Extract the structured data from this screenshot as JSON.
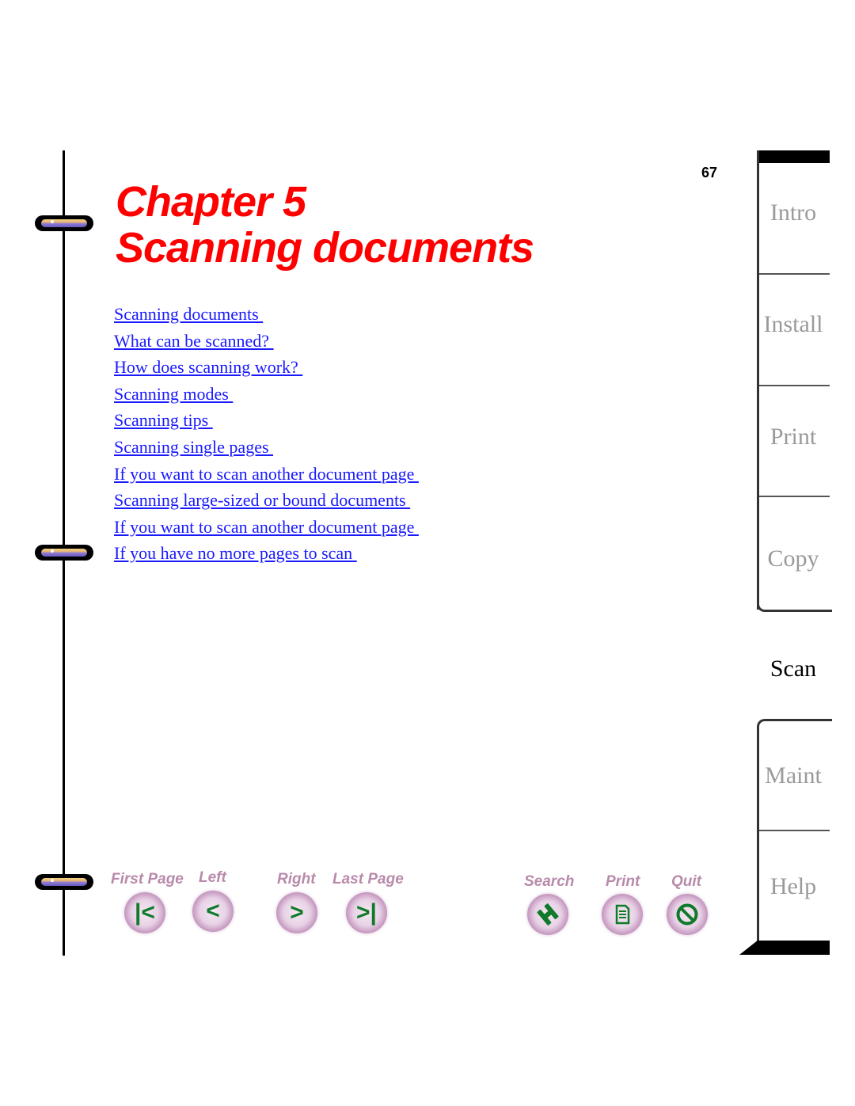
{
  "page": {
    "number": "67",
    "chapter_line": "Chapter 5",
    "title_line": "Scanning documents"
  },
  "toc": [
    "Scanning documents ",
    "What can be scanned? ",
    "How does scanning work? ",
    "Scanning modes ",
    "Scanning tips ",
    "Scanning single pages ",
    "If you want to scan another document page ",
    "Scanning large-sized or bound documents ",
    "If you want to scan another document page ",
    "If you have no more pages to scan "
  ],
  "tabs": {
    "intro": "Intro",
    "install": "Install",
    "print": "Print",
    "copy": "Copy",
    "scan": "Scan",
    "maint": "Maint",
    "help": "Help",
    "active": "Scan"
  },
  "nav": {
    "first_page": {
      "label": "First Page",
      "icon": "first-page-icon",
      "glyph": "|<"
    },
    "left": {
      "label": "Left",
      "icon": "left-arrow-icon",
      "glyph": "<"
    },
    "right": {
      "label": "Right",
      "icon": "right-arrow-icon",
      "glyph": ">"
    },
    "last_page": {
      "label": "Last Page",
      "icon": "last-page-icon",
      "glyph": ">|"
    },
    "search": {
      "label": "Search",
      "icon": "search-binoculars-icon"
    },
    "print": {
      "label": "Print",
      "icon": "print-document-icon"
    },
    "quit": {
      "label": "Quit",
      "icon": "quit-prohibit-icon"
    }
  },
  "colors": {
    "title": "#ff0000",
    "link": "#1a1aff",
    "nav_label": "#b88aaa",
    "nav_glyph": "#107a2a",
    "tab_inactive": "#9a9a9a",
    "tab_active": "#000000"
  }
}
